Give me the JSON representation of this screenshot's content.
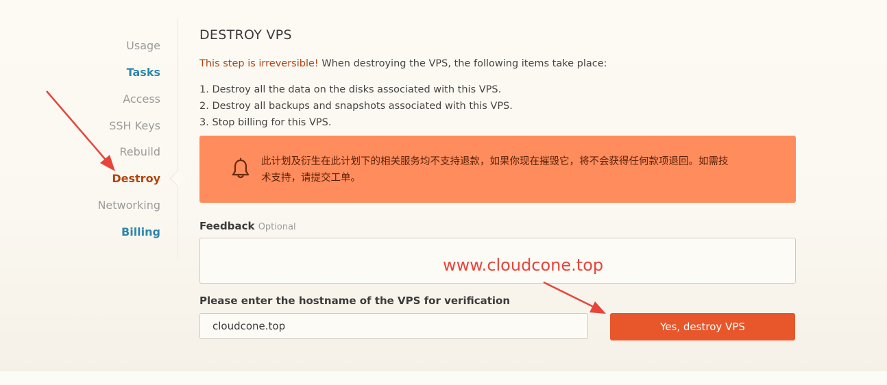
{
  "sidebar": {
    "items": [
      {
        "label": "Usage",
        "state": "inactive"
      },
      {
        "label": "Tasks",
        "state": "link"
      },
      {
        "label": "Access",
        "state": "inactive"
      },
      {
        "label": "SSH Keys",
        "state": "inactive"
      },
      {
        "label": "Rebuild",
        "state": "inactive"
      },
      {
        "label": "Destroy",
        "state": "active"
      },
      {
        "label": "Networking",
        "state": "inactive"
      },
      {
        "label": "Billing",
        "state": "link"
      }
    ]
  },
  "main": {
    "title": "DESTROY VPS",
    "intro_warning": "This step is irreversible!",
    "intro_rest": " When destroying the VPS, the following items take place:",
    "list": [
      "1. Destroy all the data on the disks associated with this VPS.",
      "2. Destroy all backups and snapshots associated with this VPS.",
      "3. Stop billing for this VPS."
    ],
    "alert": {
      "icon": "bell-icon",
      "text": "此计划及衍生在此计划下的相关服务均不支持退款，如果你现在摧毁它，将不会获得任何款项退回。如需技术支持，请提交工单。"
    },
    "feedback": {
      "label": "Feedback",
      "optional": "Optional",
      "value": ""
    },
    "hostname": {
      "label": "Please enter the hostname of the VPS for verification",
      "value": "cloudcone.top"
    },
    "destroy_button": "Yes, destroy VPS",
    "watermark": "www.cloudcone.top"
  },
  "colors": {
    "accent_orange": "#e8562b",
    "alert_bg": "#ff8c5c",
    "warning_text": "#b3420c",
    "link_blue": "#2e86ab",
    "annotation_red": "#e8443a"
  }
}
